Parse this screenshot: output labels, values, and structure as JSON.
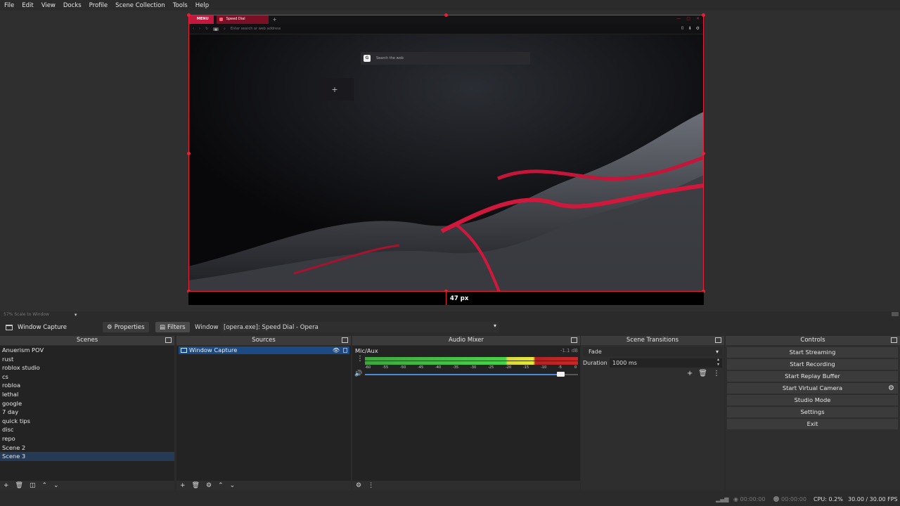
{
  "menu": [
    "File",
    "Edit",
    "View",
    "Docks",
    "Profile",
    "Scene Collection",
    "Tools",
    "Help"
  ],
  "browser": {
    "menu_label": "MENU",
    "tab_label": "Speed Dial",
    "address_placeholder": "Enter search or web address",
    "search_placeholder": "Search the web",
    "search_logo": "G",
    "add_dial": "+",
    "accent": "#e81f36"
  },
  "preview": {
    "crop_label": "47 px",
    "scale_label": "57% Scale to Window"
  },
  "source_toolbar": {
    "source_name": "Window Capture",
    "properties_label": "Properties",
    "filters_label": "Filters",
    "window_label": "Window",
    "window_value": "[opera.exe]: Speed Dial - Opera"
  },
  "scenes": {
    "title": "Scenes",
    "items": [
      "Anuerism POV",
      "rust",
      "roblox studio",
      "cs",
      "robloa",
      "lethal",
      "google",
      "7 day",
      "quick tips",
      "disc",
      "repo",
      "Scene 2",
      "Scene 3"
    ],
    "selected": "Scene 3"
  },
  "sources": {
    "title": "Sources",
    "items": [
      "Window Capture"
    ]
  },
  "mixer": {
    "title": "Audio Mixer",
    "channel": "Mic/Aux",
    "db": "-1.1 dB",
    "scale": [
      "-60",
      "-55",
      "-50",
      "-45",
      "-40",
      "-35",
      "-30",
      "-25",
      "-20",
      "-15",
      "-10",
      "-5",
      "0"
    ],
    "volume_fraction": 0.92
  },
  "transitions": {
    "title": "Scene Transitions",
    "selected": "Fade",
    "duration_label": "Duration",
    "duration_value": "1000 ms"
  },
  "controls": {
    "title": "Controls",
    "buttons": [
      "Start Streaming",
      "Start Recording",
      "Start Replay Buffer",
      "Start Virtual Camera",
      "Studio Mode",
      "Settings",
      "Exit"
    ]
  },
  "status": {
    "stream_time": "00:00:00",
    "rec_time": "00:00:00",
    "cpu": "CPU: 0.2%",
    "fps": "30.00 / 30.00 FPS"
  }
}
